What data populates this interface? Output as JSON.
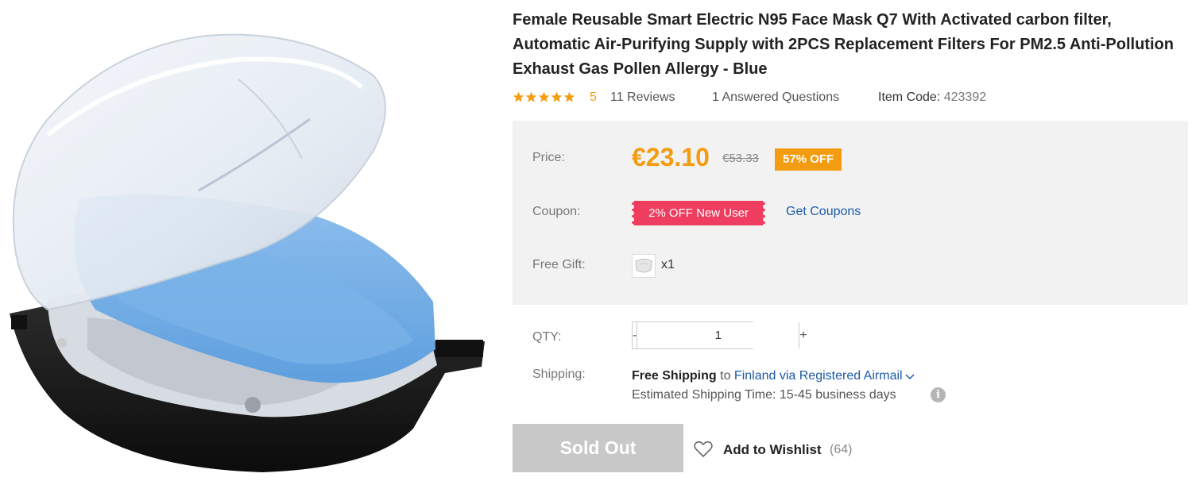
{
  "product": {
    "title": "Female Reusable Smart Electric N95 Face Mask Q7 With Activated carbon filter, Automatic Air-Purifying Supply with 2PCS Replacement Filters For PM2.5 Anti-Pollution Exhaust Gas Pollen Allergy - Blue",
    "image_icon": "mask-product-image"
  },
  "rating": {
    "stars": 5,
    "value": "5",
    "reviews_label": "11 Reviews",
    "answered_label": "1 Answered Questions",
    "item_code_label": "Item Code:",
    "item_code_value": "423392",
    "star_color": "#f39c11"
  },
  "pricing": {
    "price_label": "Price:",
    "current_price": "€23.10",
    "old_price": "€53.33",
    "discount": "57% OFF",
    "accent_color": "#f39c11"
  },
  "coupon": {
    "label": "Coupon:",
    "ticket_text": "2% OFF New User",
    "get_coupons": "Get Coupons",
    "ticket_color": "#ee3d5f"
  },
  "gift": {
    "label": "Free Gift:",
    "quantity": "x1",
    "icon": "mask-gift-icon"
  },
  "qty": {
    "label": "QTY:",
    "minus": "-",
    "value": "1",
    "plus": "+"
  },
  "shipping": {
    "label": "Shipping:",
    "free_shipping": "Free Shipping",
    "to_text": "to",
    "destination": "Finland via Registered Airmail",
    "estimate": "Estimated Shipping Time: 15-45 business days",
    "info_icon": "i"
  },
  "actions": {
    "sold_out": "Sold Out",
    "wishlist_label": "Add to Wishlist",
    "wishlist_count": "(64)"
  }
}
